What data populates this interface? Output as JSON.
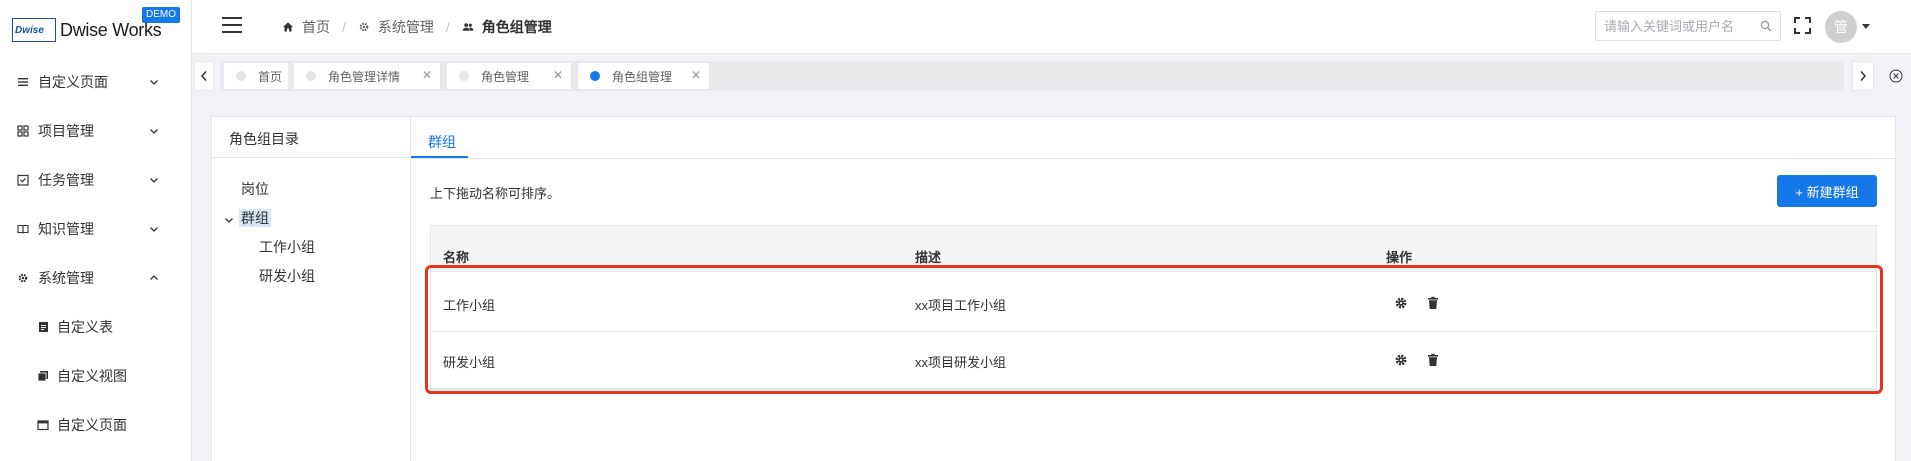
{
  "logo": {
    "text": "Dwise Works",
    "badge": "DEMO",
    "mark": "Dwise"
  },
  "sidebar": {
    "items": [
      {
        "label": "自定义页面",
        "icon": "list-icon",
        "expanded": false
      },
      {
        "label": "项目管理",
        "icon": "grid-icon",
        "expanded": false
      },
      {
        "label": "任务管理",
        "icon": "checklist-icon",
        "expanded": false
      },
      {
        "label": "知识管理",
        "icon": "book-icon",
        "expanded": false
      },
      {
        "label": "系统管理",
        "icon": "gear-icon",
        "expanded": true
      }
    ],
    "subitems": [
      {
        "label": "自定义表",
        "icon": "document-icon"
      },
      {
        "label": "自定义视图",
        "icon": "layers-icon"
      },
      {
        "label": "自定义页面",
        "icon": "window-icon"
      }
    ]
  },
  "header": {
    "breadcrumb": [
      {
        "label": "首页",
        "icon": "home-icon"
      },
      {
        "label": "系统管理",
        "icon": "gear-icon"
      },
      {
        "label": "角色组管理",
        "icon": "users-icon"
      }
    ],
    "search_placeholder": "请输入关键词或用户名",
    "avatar_text": "管"
  },
  "tabs": [
    {
      "label": "首页",
      "active": false,
      "closable": false
    },
    {
      "label": "角色管理详情",
      "active": false,
      "closable": true
    },
    {
      "label": "角色管理",
      "active": false,
      "closable": true
    },
    {
      "label": "角色组管理",
      "active": true,
      "closable": true
    }
  ],
  "left_panel": {
    "title": "角色组目录",
    "tree": {
      "root1": "岗位",
      "root2": "群组",
      "children": [
        "工作小组",
        "研发小组"
      ]
    }
  },
  "right_panel": {
    "tab": "群组",
    "hint": "上下拖动名称可排序。",
    "new_button": "+ 新建群组",
    "table": {
      "columns": [
        "名称",
        "描述",
        "操作"
      ],
      "rows": [
        {
          "name": "工作小组",
          "desc": "xx项目工作小组"
        },
        {
          "name": "研发小组",
          "desc": "xx项目研发小组"
        }
      ]
    }
  },
  "colors": {
    "accent": "#1677e8",
    "highlight": "#e8341c"
  }
}
